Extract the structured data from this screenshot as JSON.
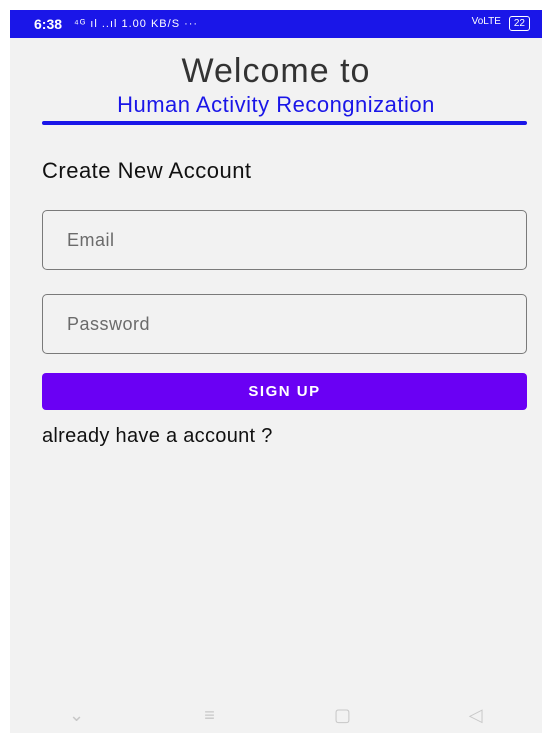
{
  "status_bar": {
    "time": "6:38",
    "indicators": "⁴ᴳ ıl ..ıl 1.00 KB/S ··· ",
    "right_indicators": "VoLTE",
    "battery": "22"
  },
  "header": {
    "welcome": "Welcome to",
    "app_name": "Human Activity Recongnization"
  },
  "form": {
    "title": "Create New Account",
    "email_placeholder": "Email",
    "password_placeholder": "Password",
    "signup_label": "SIGN UP",
    "login_link": "already have a account ?"
  },
  "nav": {
    "down": "⌄",
    "menu": "≡",
    "home": "▢",
    "back": "◁"
  },
  "colors": {
    "status_bar": "#1a16e8",
    "accent": "#6a00f4"
  }
}
